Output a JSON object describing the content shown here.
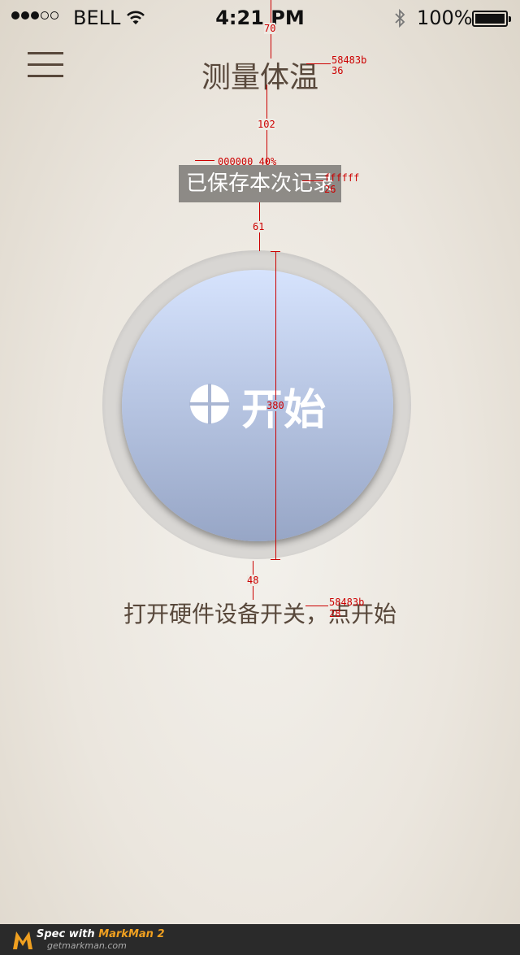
{
  "status_bar": {
    "carrier": "BELL",
    "time": "4:21 PM",
    "battery": "100%"
  },
  "nav": {
    "title": "测量体温"
  },
  "toast": {
    "text": "已保存本次记录"
  },
  "start_button": {
    "label": "开始"
  },
  "hint": {
    "text": "打开硬件设备开关，点开始"
  },
  "spec": {
    "gap_top": "70",
    "title_color": "58483b",
    "title_size": "36",
    "gap_title_toast": "102",
    "toast_bg": "000000  40%",
    "toast_color": "ffffff",
    "toast_size": "26",
    "gap_toast_button": "61",
    "button_size": "380",
    "gap_button_hint": "48",
    "hint_color": "58483b",
    "hint_size": "28"
  },
  "footer": {
    "spec_with": "Spec with",
    "app_name": "MarkMan 2",
    "site": "getmarkman.com"
  },
  "colors": {
    "text_brown": "#58483b",
    "toast_bg": "rgba(0,0,0,0.4)",
    "button_top": "#d6e3fd",
    "button_bottom": "#97a6c6"
  }
}
